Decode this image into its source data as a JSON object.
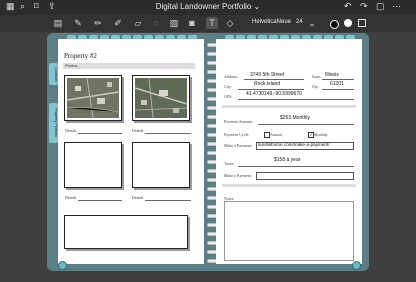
{
  "app": {
    "title": "Digital Landowner Portfolio",
    "icons": [
      "grid-icon",
      "search-icon",
      "bookmark-icon",
      "share-icon",
      "undo-icon",
      "redo-icon",
      "more-icon"
    ]
  },
  "toolbar": {
    "tools": [
      "sidebar-icon",
      "pen-icon",
      "pencil-icon",
      "highlighter-icon",
      "eraser-icon",
      "lasso-icon",
      "image-icon",
      "sticker-icon",
      "camera-icon",
      "text-icon",
      "shapes-icon",
      "link-icon"
    ],
    "font_name": "HelveticaNeue",
    "font_size": "24"
  },
  "left": {
    "title": "Property #2",
    "photos_label": "Photos",
    "details_label": "Details"
  },
  "right": {
    "address_label": "Address:",
    "address_value": "3749 5th Street",
    "state_label": "State:",
    "state_value": "Illinois",
    "city_label": "City:",
    "city_value": "Rock Island",
    "zip_label": "Zip:",
    "zip_value": "61201",
    "gps_label": "GPS:",
    "gps_value": "41.4730149,-90.5999670",
    "payment_amount_label": "Payment Amount:",
    "payment_amount_value": "$253 Monthly",
    "payment_cycle_label": "Payment Cycle:",
    "annual_label": "Annual",
    "monthly_label": "Monthly",
    "make_payment_label": "Make a Payment:",
    "make_payment_url": "landlishome.com/make-a-payment/",
    "taxes_label": "Taxes:",
    "taxes_value": "$158 a year",
    "make_payment2_label": "Make a Payment:",
    "notes_label": "Notes:"
  },
  "side_tabs": [
    "Contacts",
    "Property Portfolio"
  ]
}
